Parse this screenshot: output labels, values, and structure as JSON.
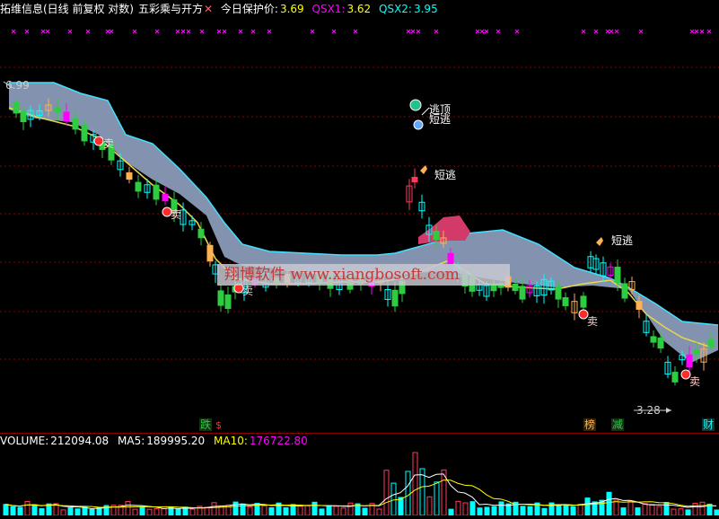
{
  "header": {
    "title": "拓维信息(日线 前复权 对数)",
    "indicator": "五彩乘与开方",
    "close_mark": "✕",
    "protect_label": "今日保护价:",
    "protect_value": "3.69",
    "qsx1_label": "QSX1:",
    "qsx1_value": "3.62",
    "qsx2_label": "QSX2:",
    "qsx2_value": "3.95"
  },
  "chart": {
    "high_label": "6.99",
    "low_label": "3.28",
    "watermark": "翔博软件 www.xiangbosoft.com",
    "signals": [
      "卖",
      "卖",
      "卖",
      "卖",
      "卖"
    ],
    "escape_top": "逃顶",
    "short_escape": [
      "短逃",
      "短逃",
      "短逃"
    ],
    "bottom_tags": {
      "die": "跌",
      "bang": "榜",
      "jian": "减",
      "cai": "财",
      "dollar": "$"
    }
  },
  "volume": {
    "label": "VOLUME:",
    "value": "212094.08",
    "ma5_label": "MA5:",
    "ma5_value": "189995.20",
    "ma10_label": "MA10:",
    "ma10_value": "176722.80"
  },
  "colors": {
    "up": "#ff3a5c",
    "down": "#00ffff",
    "green": "#2ecc40",
    "orange": "#ffb050",
    "magenta": "#ff00ff",
    "band": "#8a9bb8",
    "band_edge": "#40e0ff",
    "grid": "#8b0000",
    "yellow": "#ffff00"
  }
}
